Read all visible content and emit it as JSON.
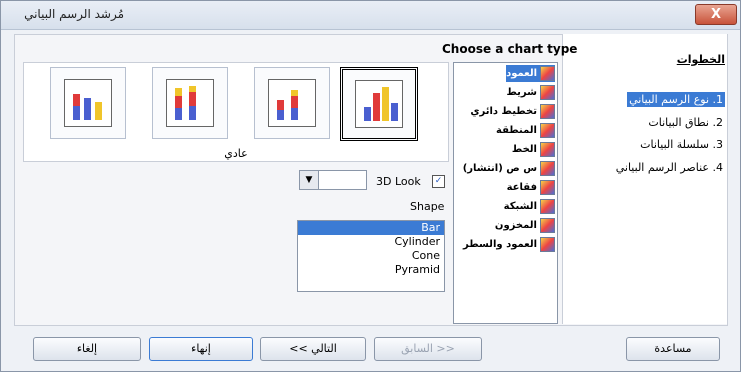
{
  "window": {
    "title": "مُرشد الرسم البياني",
    "close_label": "X"
  },
  "steps": {
    "title": "الخطوات",
    "items": [
      {
        "label": "1. نوع الرسم البياني",
        "active": true
      },
      {
        "label": "2. نطاق البيانات",
        "active": false
      },
      {
        "label": "3. سلسلة البيانات",
        "active": false
      },
      {
        "label": "4. عناصر الرسم البياني",
        "active": false
      }
    ]
  },
  "chart_type": {
    "title": "Choose a chart type",
    "types": [
      {
        "label": "العمود",
        "icon": "column-chart-icon",
        "selected": true
      },
      {
        "label": "شريط",
        "icon": "bar-chart-icon",
        "selected": false
      },
      {
        "label": "تخطيط دائري",
        "icon": "pie-chart-icon",
        "selected": false
      },
      {
        "label": "المنطقة",
        "icon": "area-chart-icon",
        "selected": false
      },
      {
        "label": "الخط",
        "icon": "line-chart-icon",
        "selected": false
      },
      {
        "label": "س ص (انتشار)",
        "icon": "scatter-chart-icon",
        "selected": false
      },
      {
        "label": "فقاعة",
        "icon": "bubble-chart-icon",
        "selected": false
      },
      {
        "label": "الشبكة",
        "icon": "net-chart-icon",
        "selected": false
      },
      {
        "label": "المخزون",
        "icon": "stock-chart-icon",
        "selected": false
      },
      {
        "label": "العمود والسطر",
        "icon": "column-line-chart-icon",
        "selected": false
      }
    ]
  },
  "variants": {
    "label": "عادي",
    "items": [
      {
        "name": "percent-stacked-3d-variant",
        "selected": false
      },
      {
        "name": "stacked-3d-variant",
        "selected": false
      },
      {
        "name": "stacked-variant",
        "selected": false
      },
      {
        "name": "normal-3d-variant",
        "selected": true
      }
    ]
  },
  "options": {
    "look_3d_label": "3D Look",
    "look_3d_checked": "✓",
    "look_dropdown_value": "",
    "dropdown_arrow": "▼",
    "shape_label": "Shape",
    "shapes": [
      {
        "label": "Bar",
        "selected": true
      },
      {
        "label": "Cylinder",
        "selected": false
      },
      {
        "label": "Cone",
        "selected": false
      },
      {
        "label": "Pyramid",
        "selected": false
      }
    ]
  },
  "buttons": {
    "help": "مساعدة",
    "back": "<< السابق",
    "next": "التالي >>",
    "finish": "إنهاء",
    "cancel": "إلغاء"
  },
  "colors": {
    "accent": "#3b7bd4",
    "close": "#c8533a"
  }
}
